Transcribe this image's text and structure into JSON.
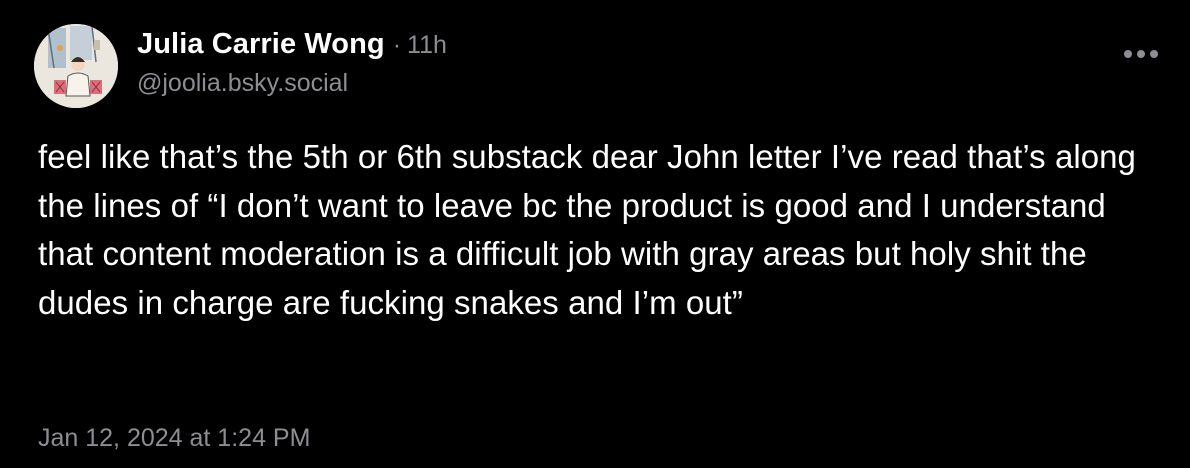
{
  "post": {
    "author": {
      "display_name": "Julia Carrie Wong",
      "handle": "@joolia.bsky.social",
      "avatar_icon": "avatar-illustration"
    },
    "separator": "·",
    "time_ago": "11h",
    "more_icon": "more-options-icon",
    "text": "feel like that’s the 5th or 6th substack dear John letter I’ve read that’s along the lines of “I don’t want to leave bc the product is good and I understand that content moderation is a difficult job with gray areas but holy shit the dudes in charge are fucking snakes and I’m out”",
    "timestamp": "Jan 12, 2024 at 1:24 PM"
  },
  "colors": {
    "background": "#000000",
    "primary_text": "#ffffff",
    "secondary_text": "#8d8d93"
  }
}
